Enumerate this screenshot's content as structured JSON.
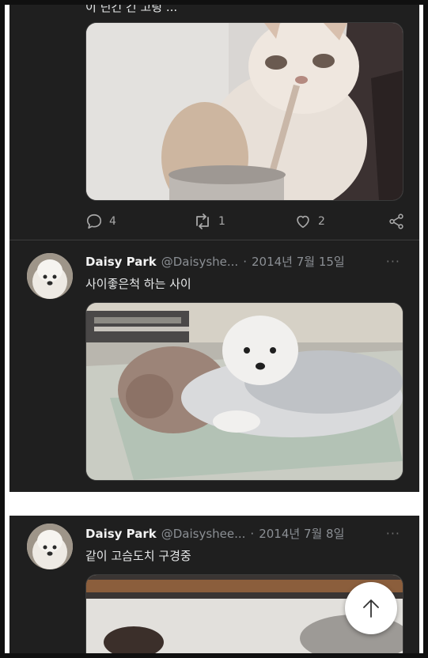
{
  "tweet_top": {
    "cut_text": "이 딘긴 긴 고링 ...",
    "stats": {
      "replies": "4",
      "retweets": "1",
      "likes": "2"
    }
  },
  "tweet_2": {
    "author": "Daisy Park",
    "handle": "@Daisyshe...",
    "separator": "·",
    "date": "2014년 7월 15일",
    "more": "···",
    "text": "사이좋은척 하는 사이"
  },
  "tweet_3": {
    "author": "Daisy Park",
    "handle": "@Daisyshee...",
    "separator": "·",
    "date": "2014년 7월 8일",
    "more": "···",
    "text": "같이 고슴도치 구경중"
  },
  "colors": {
    "panel_bg": "#1f1f1f",
    "text": "#e7e9ea",
    "muted": "#8b8f94",
    "icon": "#a8a8a8"
  },
  "icons": {
    "reply": "reply-icon",
    "retweet": "retweet-icon",
    "like": "heart-icon",
    "share": "share-icon",
    "scroll_top": "arrow-up-icon"
  }
}
